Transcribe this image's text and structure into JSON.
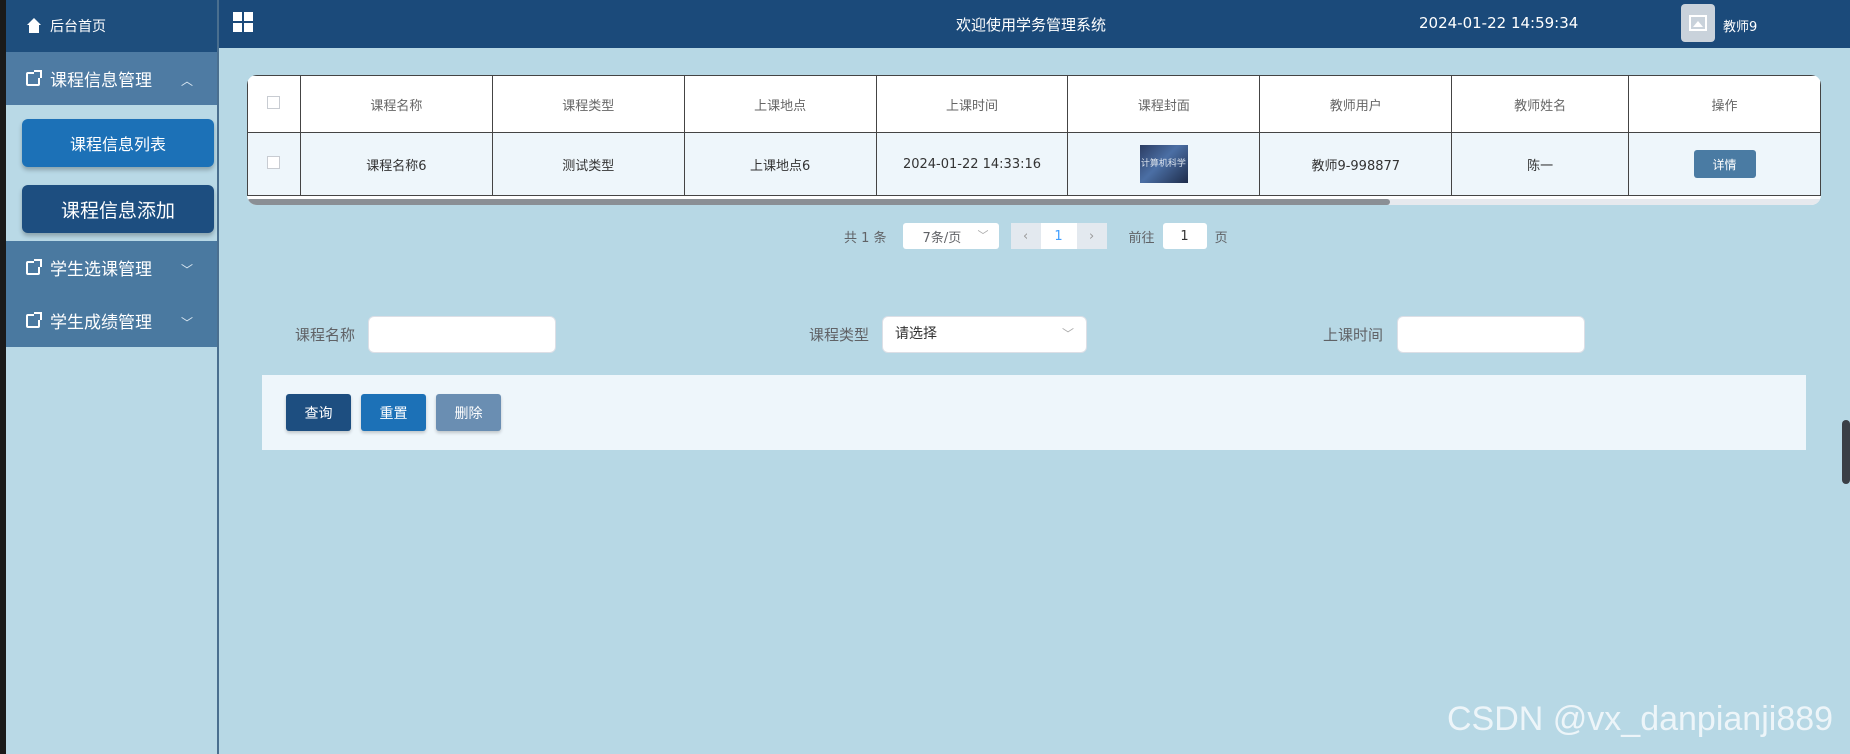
{
  "sidebar": {
    "home_label": "后台首页",
    "groups": [
      {
        "label": "课程信息管理",
        "expanded": true,
        "items": [
          "课程信息列表",
          "课程信息添加"
        ]
      },
      {
        "label": "学生选课管理",
        "expanded": false
      },
      {
        "label": "学生成绩管理",
        "expanded": false
      }
    ]
  },
  "header": {
    "title": "欢迎使用学务管理系统",
    "datetime": "2024-01-22 14:59:34",
    "user": "教师9"
  },
  "table": {
    "columns": [
      "课程名称",
      "课程类型",
      "上课地点",
      "上课时间",
      "课程封面",
      "教师用户",
      "教师姓名",
      "操作"
    ],
    "rows": [
      {
        "name": "课程名称6",
        "type": "测试类型",
        "location": "上课地点6",
        "time": "2024-01-22 14:33:16",
        "cover_text": "计算机科学",
        "teacher_user": "教师9-998877",
        "teacher_name": "陈一",
        "action": "详情"
      }
    ]
  },
  "pager": {
    "total": "共 1 条",
    "page_size": "7条/页",
    "current": "1",
    "goto_label": "前往",
    "goto_value": "1",
    "page_unit": "页"
  },
  "search": {
    "name_label": "课程名称",
    "type_label": "课程类型",
    "type_placeholder": "请选择",
    "time_label": "上课时间"
  },
  "buttons": {
    "query": "查询",
    "reset": "重置",
    "delete": "删除"
  },
  "watermark": "CSDN @vx_danpianji889",
  "colors": {
    "header_bg": "#1b4a7a",
    "page_bg": "#b7d8e5",
    "sidebar_group_bg": "#4e7ba3",
    "primary_btn": "#1c71b7"
  }
}
